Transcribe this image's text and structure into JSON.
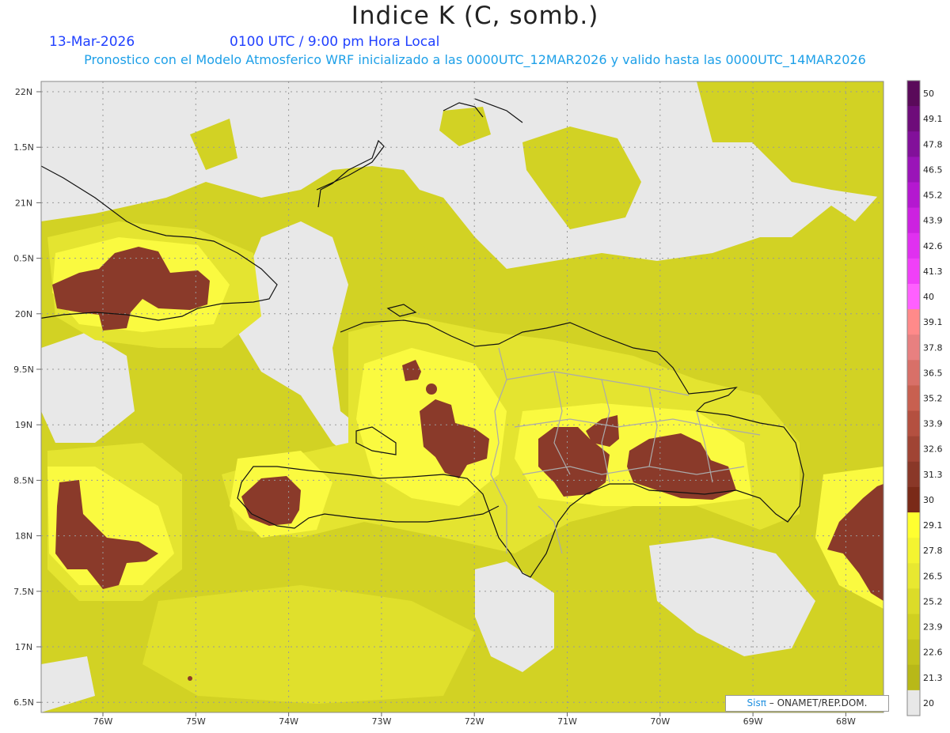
{
  "header": {
    "title": "Indice K (C, somb.)",
    "date": "13-Mar-2026",
    "time": "0100 UTC / 9:00 pm Hora Local",
    "description": "Pronostico con el Modelo Atmosferico WRF inicializado a las 0000UTC_12MAR2026 y valido hasta las  0000UTC_14MAR2026"
  },
  "axes": {
    "lon_labels": [
      "76W",
      "75W",
      "74W",
      "73W",
      "72W",
      "71W",
      "70W",
      "69W",
      "68W"
    ],
    "lat_labels": [
      "22N",
      "1.5N",
      "21N",
      "0.5N",
      "20N",
      "9.5N",
      "19N",
      "8.5N",
      "18N",
      "7.5N",
      "17N",
      "6.5N"
    ]
  },
  "colorbar": {
    "labels": [
      "50",
      "49.1",
      "47.8",
      "46.5",
      "45.2",
      "43.9",
      "42.6",
      "41.3",
      "40",
      "39.1",
      "37.8",
      "36.5",
      "35.2",
      "33.9",
      "32.6",
      "31.3",
      "30",
      "29.1",
      "27.8",
      "26.5",
      "25.2",
      "23.9",
      "22.6",
      "21.3",
      "20"
    ],
    "colors": [
      "#5a0a5a",
      "#6e0c7a",
      "#82109a",
      "#9a14b8",
      "#b418d0",
      "#cc22e0",
      "#e030f0",
      "#f040f8",
      "#ff60ff",
      "#ff8a8a",
      "#e88080",
      "#d87068",
      "#c86050",
      "#b45040",
      "#a04434",
      "#8a3828",
      "#7a2a18",
      "#ffff30",
      "#f4f430",
      "#e8e830",
      "#dcdc28",
      "#d0d020",
      "#c4c41c",
      "#b8b818",
      "#e8e8e8"
    ]
  },
  "colors": {
    "no_data": "#e8e8e8",
    "low": "#c8c820",
    "mid": "#e4e430",
    "high": "#ffff40",
    "extreme": "#8a3a2a"
  },
  "credit": {
    "brand": "Sisπ",
    "text": "– ONAMET/REP.DOM."
  }
}
